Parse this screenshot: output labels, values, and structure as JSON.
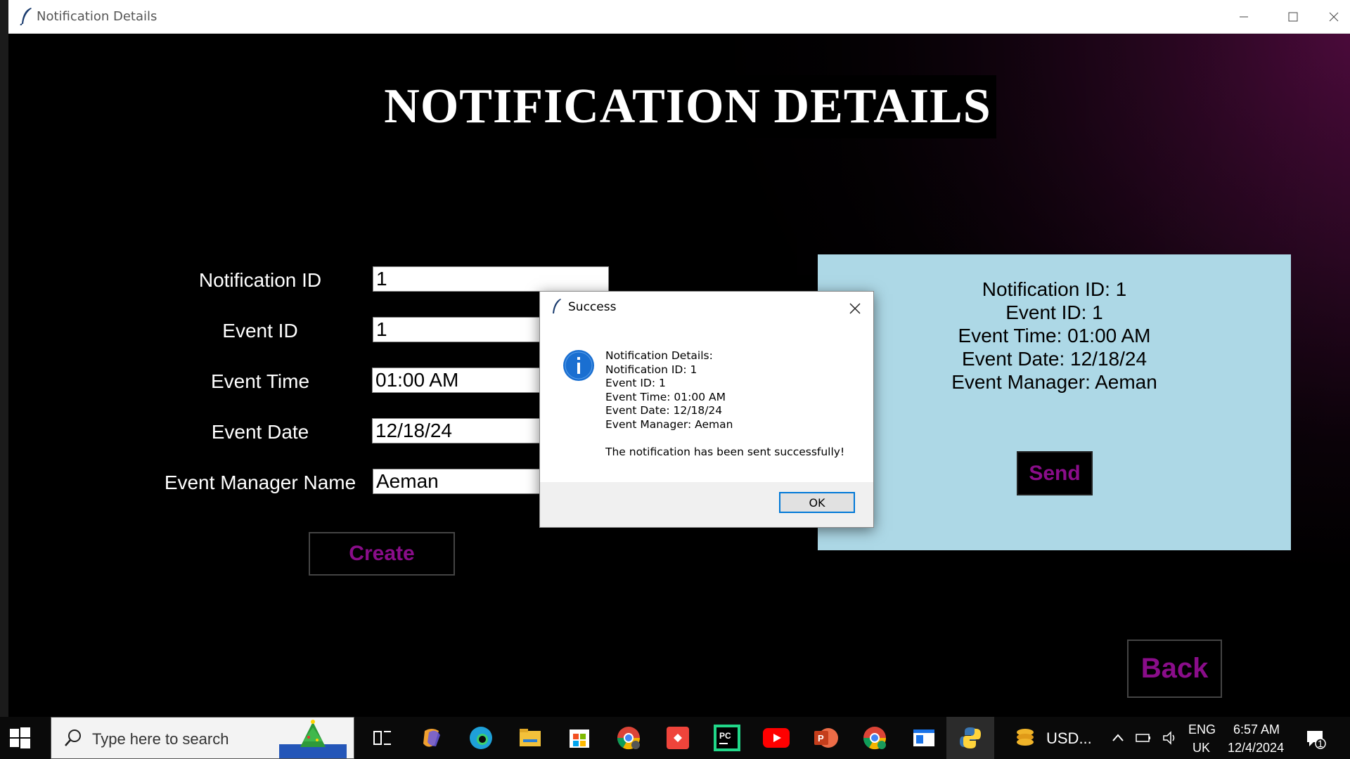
{
  "window": {
    "title": "Notification Details",
    "icon": "feather-icon"
  },
  "heading": "NOTIFICATION DETAILS",
  "form": {
    "fields": [
      {
        "label": "Notification ID",
        "value": "1"
      },
      {
        "label": "Event ID",
        "value": "1"
      },
      {
        "label": "Event Time",
        "value": "01:00 AM"
      },
      {
        "label": "Event Date",
        "value": "12/18/24"
      },
      {
        "label": "Event Manager Name",
        "value": "Aeman"
      }
    ],
    "create_label": "Create"
  },
  "panel": {
    "lines": [
      "Notification ID: 1",
      "Event ID: 1",
      "Event Time: 01:00 AM",
      "Event Date: 12/18/24",
      "Event Manager: Aeman"
    ],
    "send_label": "Send",
    "background": "#add8e6"
  },
  "back_label": "Back",
  "dialog": {
    "title": "Success",
    "lines": [
      "Notification Details:",
      "Notification ID: 1",
      "Event ID: 1",
      "Event Time: 01:00 AM",
      "Event Date: 12/18/24",
      "Event Manager: Aeman"
    ],
    "footer_message": "The notification has been sent successfully!",
    "ok_label": "OK",
    "icon": "info-icon"
  },
  "taskbar": {
    "search_placeholder": "Type here to search",
    "app_label": "USD...",
    "language": "ENG",
    "region": "UK",
    "time": "6:57 AM",
    "date": "12/4/2024",
    "notification_count": "1"
  },
  "colors": {
    "button_text": "#8a0d8a",
    "accent": "#0078d7"
  }
}
